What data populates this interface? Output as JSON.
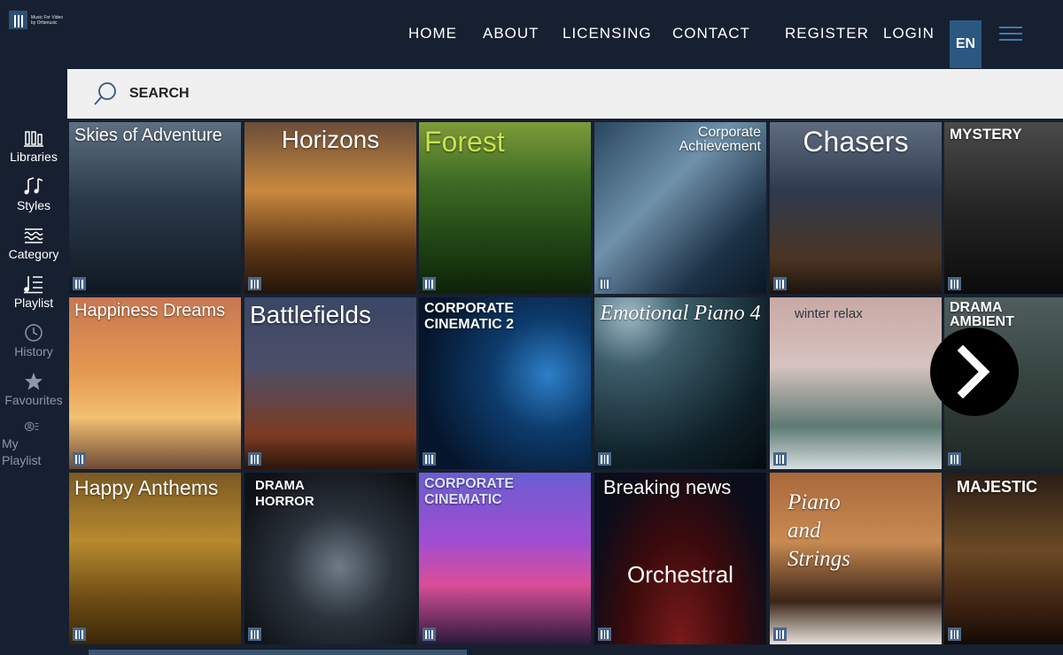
{
  "logo": {
    "line1": "Music For Video",
    "line2": "by Orfamusic"
  },
  "nav": {
    "home": "HOME",
    "about": "ABOUT",
    "licensing": "LICENSING",
    "contact": "CONTACT",
    "register": "REGISTER",
    "login": "LOGIN",
    "language": "EN"
  },
  "search": {
    "placeholder": "SEARCH"
  },
  "sidebar": {
    "libraries": "Libraries",
    "styles": "Styles",
    "category": "Category",
    "playlist": "Playlist",
    "history": "History",
    "favourites": "Favourites",
    "my_playlist_1": "My",
    "my_playlist_2": "Playlist"
  },
  "albums": [
    {
      "title": "Skies of Adventure"
    },
    {
      "title": "Horizons"
    },
    {
      "title": "Forest"
    },
    {
      "title": "Corporate Achievement"
    },
    {
      "title": "Chasers"
    },
    {
      "title": "MYSTERY"
    },
    {
      "title": "Happiness Dreams"
    },
    {
      "title": "Battlefields"
    },
    {
      "title": "CORPORATE CINEMATIC 2"
    },
    {
      "title": "Emotional Piano 4"
    },
    {
      "title": "winter relax"
    },
    {
      "title": "DRAMA AMBIENT"
    },
    {
      "title": "Happy Anthems"
    },
    {
      "title": "DRAMA HORROR"
    },
    {
      "title": "CORPORATE CINEMATIC"
    },
    {
      "title": "Breaking news",
      "subtitle": "Orchestral"
    },
    {
      "title": "Piano and Strings"
    },
    {
      "title": "MAJESTIC"
    }
  ]
}
